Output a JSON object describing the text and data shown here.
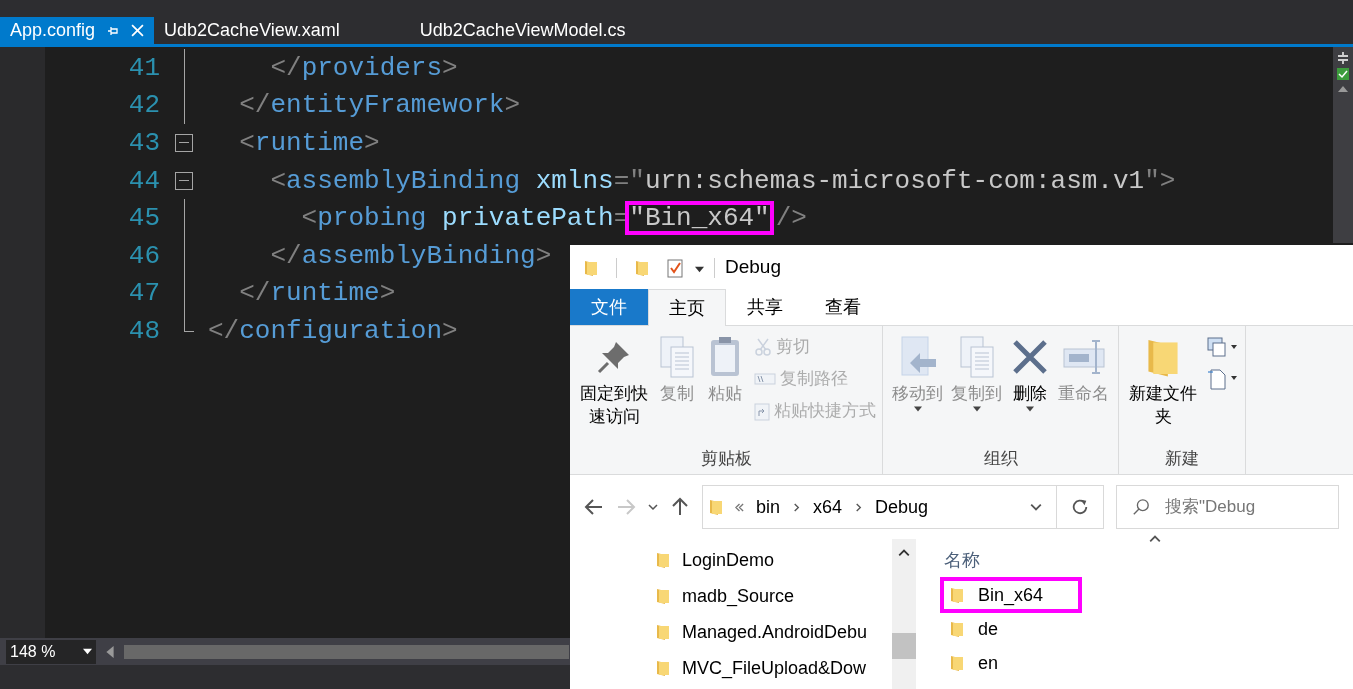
{
  "editor_tabs": [
    {
      "label": "App.config",
      "selected": true
    },
    {
      "label": "Udb2CacheView.xaml",
      "selected": false
    },
    {
      "label": "Udb2CacheViewModel.cs",
      "selected": false
    }
  ],
  "code_lines": [
    {
      "children": [
        {
          "children": [
            {
              "number": "41",
              "collapsible": false,
              "tokens": [
                {
                  "kind": "delim",
                  "text": "</"
                },
                {
                  "kind": "tag",
                  "text": "providers"
                },
                {
                  "kind": "delim",
                  "text": ">"
                }
              ]
            }
          ]
        },
        {
          "number": "42",
          "collapsible": false,
          "tokens": [
            {
              "kind": "delim",
              "text": "</"
            },
            {
              "kind": "tag",
              "text": "entityFramework"
            },
            {
              "kind": "delim",
              "text": ">"
            }
          ]
        },
        {
          "number": "43",
          "collapsible": true,
          "tokens": [
            {
              "kind": "delim",
              "text": "<"
            },
            {
              "kind": "tag",
              "text": "runtime"
            },
            {
              "kind": "delim",
              "text": ">"
            }
          ]
        },
        {
          "children": [
            {
              "number": "44",
              "collapsible": true,
              "tokens": [
                {
                  "kind": "delim",
                  "text": "<"
                },
                {
                  "kind": "tag",
                  "text": "assemblyBinding"
                },
                {
                  "kind": "attr",
                  "text": "xmlns"
                },
                {
                  "kind": "delim",
                  "text": "=\""
                },
                {
                  "kind": "value",
                  "text": "urn:schemas-microsoft-com:asm.v1"
                },
                {
                  "kind": "delim",
                  "text": "\">"
                }
              ]
            },
            {
              "children": [
                {
                  "number": "45",
                  "collapsible": false,
                  "tokens": [
                    {
                      "kind": "delim",
                      "text": "<"
                    },
                    {
                      "kind": "tag",
                      "text": "probing"
                    },
                    {
                      "kind": "attr",
                      "text": "privatePath"
                    },
                    {
                      "kind": "delim",
                      "text": "="
                    },
                    {
                      "kind": "value",
                      "text": "\"Bin_x64\"",
                      "highlighted": true
                    },
                    {
                      "kind": "delim",
                      "text": "/>"
                    }
                  ]
                }
              ]
            },
            {
              "number": "46",
              "collapsible": false,
              "tokens": [
                {
                  "kind": "delim",
                  "text": "</"
                },
                {
                  "kind": "tag",
                  "text": "assemblyBinding"
                },
                {
                  "kind": "delim",
                  "text": ">"
                }
              ]
            }
          ]
        },
        {
          "number": "47",
          "collapsible": false,
          "tokens": [
            {
              "kind": "delim",
              "text": "</"
            },
            {
              "kind": "tag",
              "text": "runtime"
            },
            {
              "kind": "delim",
              "text": ">"
            }
          ]
        }
      ]
    },
    {
      "number": "48",
      "collapsible": false,
      "tokens": [
        {
          "kind": "delim",
          "text": "</"
        },
        {
          "kind": "tag",
          "text": "configuration"
        },
        {
          "kind": "delim",
          "text": ">"
        }
      ]
    }
  ],
  "zoom": {
    "value": "148 %"
  },
  "explorer": {
    "title": "Debug",
    "ribbon_tabs": [
      {
        "label": "文件",
        "kind": "file",
        "selected": false
      },
      {
        "label": "主页",
        "kind": "tab",
        "selected": true
      },
      {
        "label": "共享",
        "kind": "tab",
        "selected": false
      },
      {
        "label": "查看",
        "kind": "tab",
        "selected": false
      }
    ],
    "groups": [
      {
        "label": "剪贴板",
        "large": [
          {
            "label": "固定到快速访问",
            "disabled": false,
            "dropdown": false
          },
          {
            "label": "复制",
            "disabled": true,
            "dropdown": false
          },
          {
            "label": "粘贴",
            "disabled": true,
            "dropdown": false
          }
        ],
        "small": [
          {
            "label": "剪切",
            "disabled": true
          },
          {
            "label": "复制路径",
            "disabled": true
          },
          {
            "label": "粘贴快捷方式",
            "disabled": true
          }
        ]
      },
      {
        "label": "组织",
        "large": [
          {
            "label": "移动到",
            "disabled": true,
            "dropdown": true
          },
          {
            "label": "复制到",
            "disabled": true,
            "dropdown": true
          },
          {
            "label": "删除",
            "disabled": false,
            "dropdown": true
          },
          {
            "label": "重命名",
            "disabled": true,
            "dropdown": false
          }
        ]
      },
      {
        "label": "新建",
        "large": [
          {
            "label": "新建文件夹",
            "disabled": false,
            "dropdown": false
          }
        ],
        "small": [
          {
            "disabled": false
          },
          {
            "disabled": false
          }
        ]
      }
    ],
    "breadcrumb": [
      "bin",
      "x64",
      "Debug"
    ],
    "search": {
      "placeholder": "搜索\"Debug"
    },
    "nav_items": [
      "LoginDemo",
      "madb_Source",
      "Managed.AndroidDebu",
      "MVC_FileUpload&Dow"
    ],
    "column_header": "名称",
    "files": [
      {
        "name": "Bin_x64",
        "highlighted": true
      },
      {
        "name": "de",
        "highlighted": false
      },
      {
        "name": "en",
        "highlighted": false
      }
    ]
  }
}
